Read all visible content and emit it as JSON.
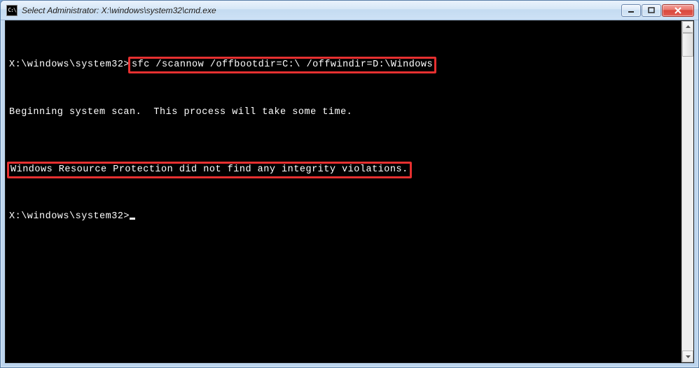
{
  "window": {
    "title": "Select Administrator: X:\\windows\\system32\\cmd.exe",
    "app_icon_label": "C:\\"
  },
  "terminal": {
    "blank_line1": "",
    "prompt1_prefix": "X:\\windows\\system32>",
    "prompt1_command": "sfc /scannow /offbootdir=C:\\ /offwindir=D:\\Windows",
    "line2": "Beginning system scan.  This process will take some time.",
    "line3": "Windows Resource Protection did not find any integrity violations.",
    "prompt2_prefix": "X:\\windows\\system32>"
  },
  "colors": {
    "highlight": "#e63030",
    "terminal_bg": "#000000",
    "terminal_fg": "#ffffff"
  }
}
